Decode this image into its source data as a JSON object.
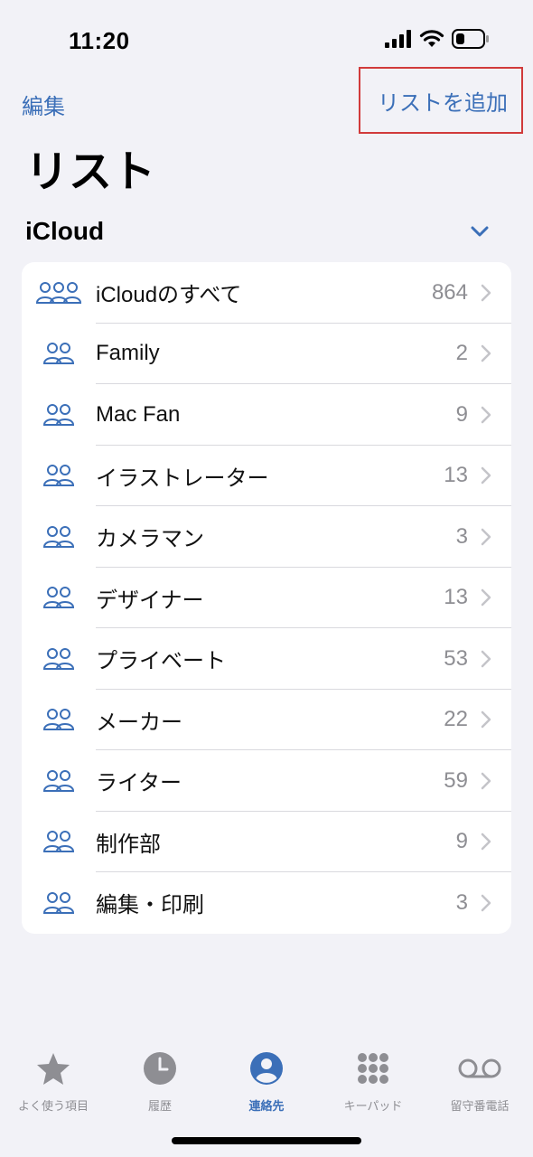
{
  "status_bar": {
    "time": "11:20"
  },
  "nav": {
    "edit_label": "編集",
    "add_list_label": "リストを追加"
  },
  "page_title": "リスト",
  "section": {
    "title": "iCloud",
    "expanded_icon": "chevron-down-icon"
  },
  "lists": [
    {
      "label": "iCloudのすべて",
      "count": "864",
      "icon": "group-three-icon"
    },
    {
      "label": "Family",
      "count": "2",
      "icon": "group-icon"
    },
    {
      "label": "Mac Fan",
      "count": "9",
      "icon": "group-icon"
    },
    {
      "label": "イラストレーター",
      "count": "13",
      "icon": "group-icon"
    },
    {
      "label": "カメラマン",
      "count": "3",
      "icon": "group-icon"
    },
    {
      "label": "デザイナー",
      "count": "13",
      "icon": "group-icon"
    },
    {
      "label": "プライベート",
      "count": "53",
      "icon": "group-icon"
    },
    {
      "label": "メーカー",
      "count": "22",
      "icon": "group-icon"
    },
    {
      "label": "ライター",
      "count": "59",
      "icon": "group-icon"
    },
    {
      "label": "制作部",
      "count": "9",
      "icon": "group-icon"
    },
    {
      "label": "編集・印刷",
      "count": "3",
      "icon": "group-icon"
    }
  ],
  "tabs": [
    {
      "label": "よく使う項目",
      "icon": "star-icon",
      "active": false
    },
    {
      "label": "履歴",
      "icon": "clock-icon",
      "active": false
    },
    {
      "label": "連絡先",
      "icon": "person-circle-icon",
      "active": true
    },
    {
      "label": "キーパッド",
      "icon": "keypad-icon",
      "active": false
    },
    {
      "label": "留守番電話",
      "icon": "voicemail-icon",
      "active": false
    }
  ],
  "colors": {
    "accent": "#3b6fb8",
    "background": "#f2f2f7",
    "highlight_border": "#d13b3b",
    "secondary_text": "#8e8e93"
  }
}
